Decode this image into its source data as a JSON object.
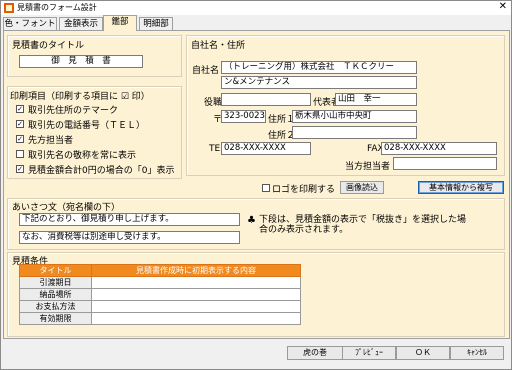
{
  "window": {
    "title": "見積書のフォーム設計",
    "close": "✕"
  },
  "tabs": [
    {
      "label": "色・フォント"
    },
    {
      "label": "金額表示"
    },
    {
      "label": "鑑部"
    },
    {
      "label": "明細部"
    }
  ],
  "title_group": {
    "heading": "見積書のタイトル",
    "value": "御　見　積　書"
  },
  "print_group": {
    "heading": "印刷項目（印刷する項目に ☑ 印）",
    "items": [
      {
        "label": "取引先住所のテマーク",
        "checked": true
      },
      {
        "label": "取引先の電話番号（ＴＥＬ）",
        "checked": true
      },
      {
        "label": "先方担当者",
        "checked": true
      },
      {
        "label": "取引先名の敬称を常に表示",
        "checked": false
      },
      {
        "label": "見積金額合計0円の場合の「0」表示",
        "checked": true
      }
    ]
  },
  "company": {
    "heading": "自社名・住所",
    "name_label": "自社名",
    "name1": "（トレーニング用）株式会社　ＴＫＣクリー",
    "name2": "ン&メンテナンス",
    "title_label": "役職",
    "title_value": "",
    "rep_label": "代表者",
    "rep_value": "山田　幸一",
    "postal_mark": "〒",
    "postal": "323-0023",
    "addr1_label": "住所１",
    "addr1": "栃木県小山市中央町",
    "addr2_label": "住所２",
    "addr2": "",
    "tel_label": "TEL",
    "tel": "028-XXX-XXXX",
    "fax_label": "FAX",
    "fax": "028-XXX-XXXX",
    "staff_label": "当方担当者",
    "staff": ""
  },
  "logo": {
    "check_label": "ロゴを印刷する",
    "checked": false,
    "image_button": "画像読込",
    "copy_button": "基本情報から複写"
  },
  "greeting": {
    "heading": "あいさつ文（宛名欄の下）",
    "line1": "下記のとおり、御見積り申し上げます。",
    "line2": "なお、消費税等は別途申し受けます。",
    "note_mark": "♣",
    "note": "下段は、見積金額の表示で「税抜き」を選択した場合のみ表示されます。"
  },
  "conditions": {
    "heading": "見積条件",
    "col_title": "タイトル",
    "col_content": "見積書作成時に初期表示する内容",
    "rows": [
      {
        "title": "引渡期日",
        "content": ""
      },
      {
        "title": "納品場所",
        "content": ""
      },
      {
        "title": "お支払方法",
        "content": ""
      },
      {
        "title": "有効期限",
        "content": ""
      }
    ]
  },
  "footer": {
    "buttons": [
      "虎の巻",
      "ﾌﾟﾚﾋﾞｭｰ",
      "ＯＫ",
      "ｷｬﾝｾﾙ"
    ]
  }
}
